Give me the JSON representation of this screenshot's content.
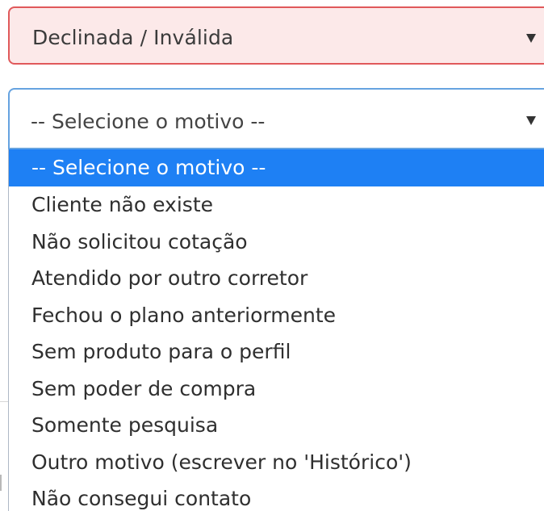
{
  "status_select": {
    "value": "Declinada / Inválida",
    "state": "error",
    "caret_icon": "caret-down-icon"
  },
  "reason_select": {
    "value": "-- Selecione o motivo --",
    "state": "open",
    "caret_icon": "caret-down-icon",
    "options": [
      "-- Selecione o motivo --",
      "Cliente não existe",
      "Não solicitou cotação",
      "Atendido por outro corretor",
      "Fechou o plano anteriormente",
      "Sem produto para o perfil",
      "Sem poder de compra",
      "Somente pesquisa",
      "Outro motivo (escrever no 'Histórico')",
      "Não consegui contato"
    ],
    "highlighted_index": 0
  },
  "colors": {
    "error_border": "#e0595b",
    "error_background": "#fce9e9",
    "focus_border": "#66a3e0",
    "highlight": "#1e80f4"
  }
}
